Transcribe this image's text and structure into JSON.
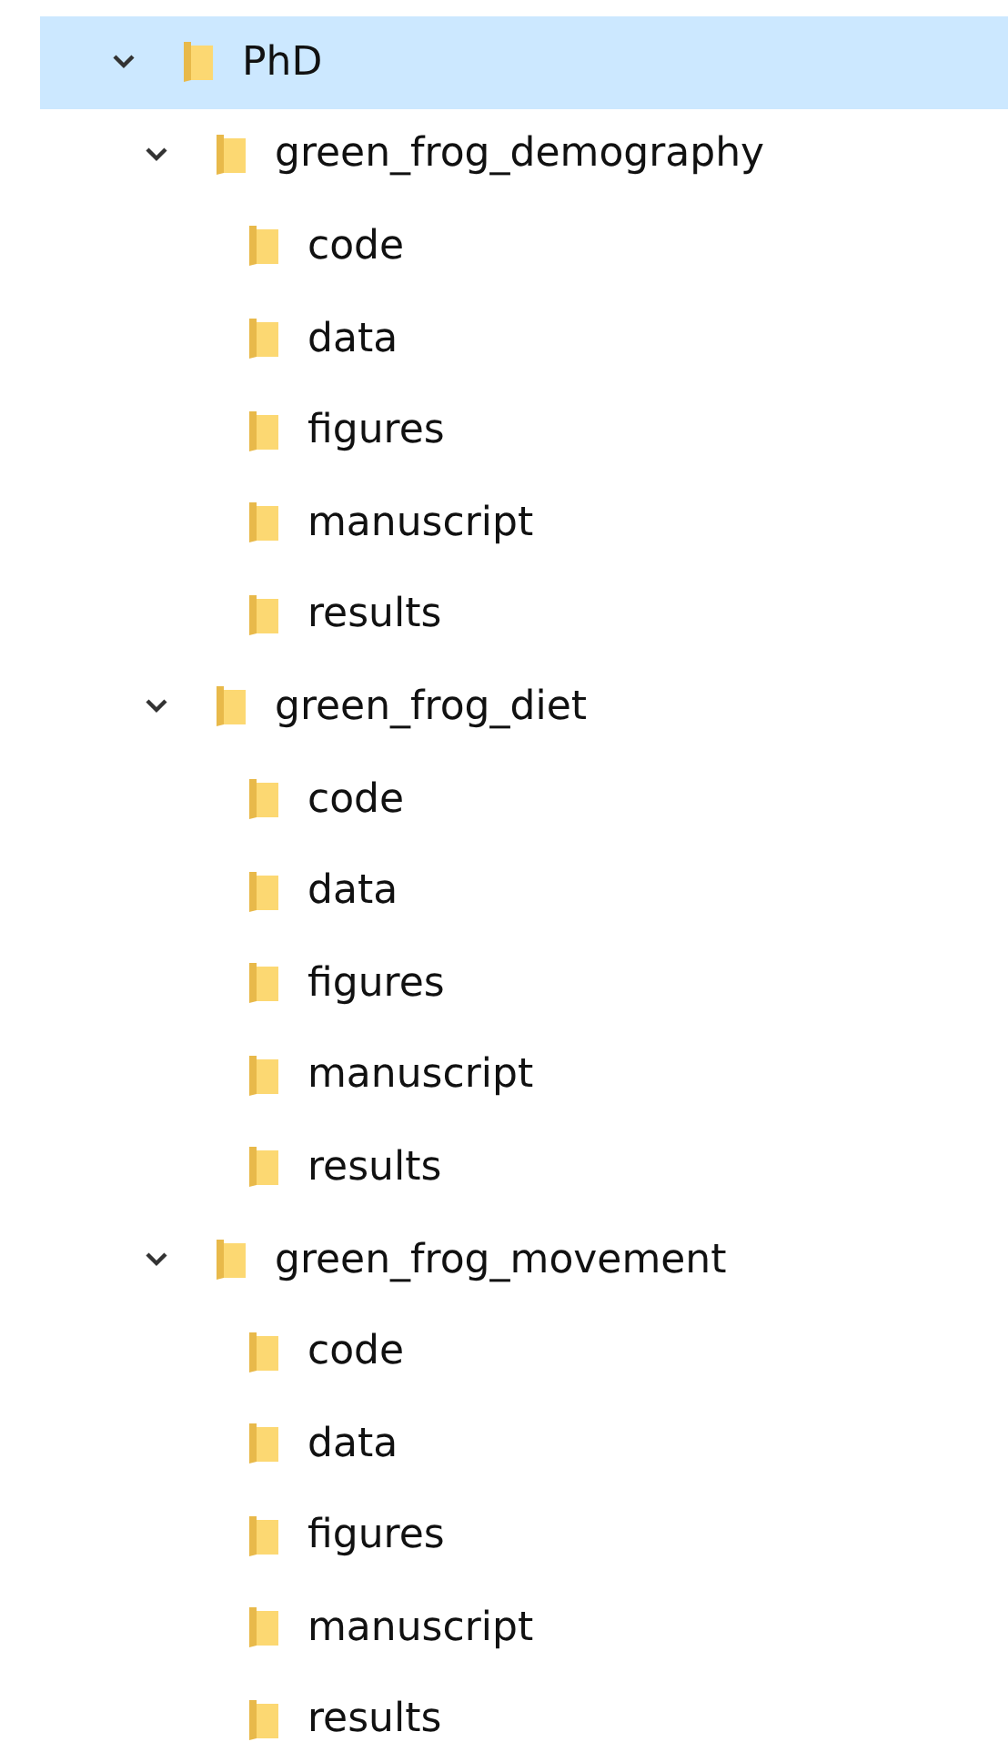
{
  "tree": [
    {
      "label": "PhD",
      "expanded": true,
      "selected": true,
      "children": [
        {
          "label": "green_frog_demography",
          "expanded": true,
          "selected": false,
          "children": [
            {
              "label": "code",
              "selected": false
            },
            {
              "label": "data",
              "selected": false
            },
            {
              "label": "figures",
              "selected": false
            },
            {
              "label": "manuscript",
              "selected": false
            },
            {
              "label": "results",
              "selected": false
            }
          ]
        },
        {
          "label": "green_frog_diet",
          "expanded": true,
          "selected": false,
          "children": [
            {
              "label": "code",
              "selected": false
            },
            {
              "label": "data",
              "selected": false
            },
            {
              "label": "figures",
              "selected": false
            },
            {
              "label": "manuscript",
              "selected": false
            },
            {
              "label": "results",
              "selected": false
            }
          ]
        },
        {
          "label": "green_frog_movement",
          "expanded": true,
          "selected": false,
          "children": [
            {
              "label": "code",
              "selected": false
            },
            {
              "label": "data",
              "selected": false
            },
            {
              "label": "figures",
              "selected": false
            },
            {
              "label": "manuscript",
              "selected": false
            },
            {
              "label": "results",
              "selected": false
            }
          ]
        }
      ]
    }
  ]
}
